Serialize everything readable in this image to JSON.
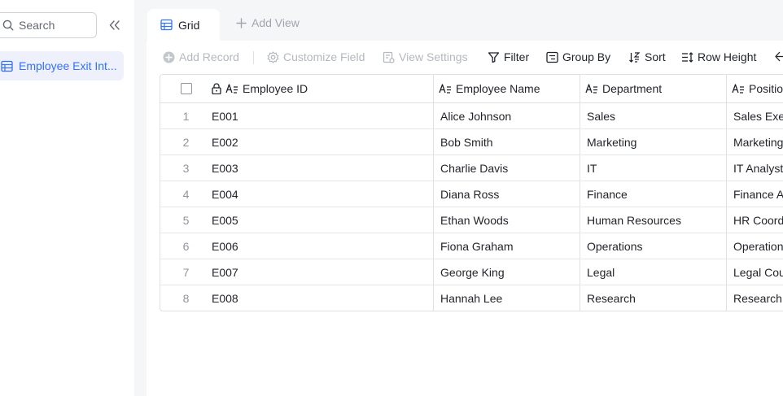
{
  "sidebar": {
    "search_placeholder": "Search",
    "items": [
      {
        "label": "Employee Exit Int..."
      }
    ]
  },
  "tabs": {
    "grid_label": "Grid",
    "add_view_label": "Add View"
  },
  "toolbar": {
    "add_record": "Add Record",
    "customize_field": "Customize Field",
    "view_settings": "View Settings",
    "filter": "Filter",
    "group_by": "Group By",
    "sort": "Sort",
    "row_height": "Row Height"
  },
  "table": {
    "columns": [
      "Employee ID",
      "Employee Name",
      "Department",
      "Positio"
    ],
    "rows": [
      {
        "num": "1",
        "id": "E001",
        "name": "Alice Johnson",
        "dept": "Sales",
        "pos": "Sales Exe"
      },
      {
        "num": "2",
        "id": "E002",
        "name": "Bob Smith",
        "dept": "Marketing",
        "pos": "Marketing"
      },
      {
        "num": "3",
        "id": "E003",
        "name": "Charlie Davis",
        "dept": "IT",
        "pos": "IT Analyst"
      },
      {
        "num": "4",
        "id": "E004",
        "name": "Diana Ross",
        "dept": "Finance",
        "pos": "Finance A"
      },
      {
        "num": "5",
        "id": "E005",
        "name": "Ethan Woods",
        "dept": "Human Resources",
        "pos": "HR Coord"
      },
      {
        "num": "6",
        "id": "E006",
        "name": "Fiona Graham",
        "dept": "Operations",
        "pos": "Operation"
      },
      {
        "num": "7",
        "id": "E007",
        "name": "George King",
        "dept": "Legal",
        "pos": "Legal Cou"
      },
      {
        "num": "8",
        "id": "E008",
        "name": "Hannah Lee",
        "dept": "Research",
        "pos": "Research"
      }
    ]
  },
  "colors": {
    "accent": "#3370ff",
    "sidebar_active_bg": "#eef1fb",
    "disabled_text": "#b4b8bf",
    "border": "#dee0e3"
  }
}
